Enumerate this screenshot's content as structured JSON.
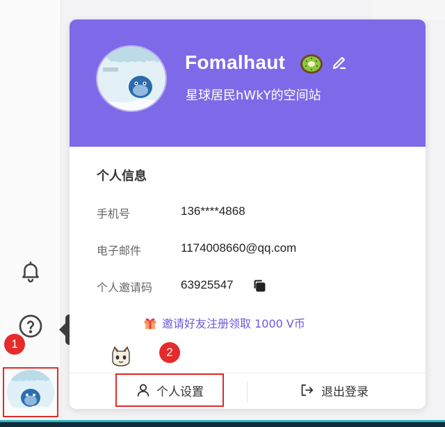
{
  "tooltip": {
    "help_label": "帮助"
  },
  "markers": {
    "one": "1",
    "two": "2"
  },
  "profile": {
    "username": "Fomalhaut",
    "space_name": "星球居民hWkY的空间站",
    "avatar_icon": "bird-in-snow-avatar",
    "emoji_icon": "kiwi-icon"
  },
  "info": {
    "section_title": "个人信息",
    "phone_label": "手机号",
    "phone_value": "136****4868",
    "email_label": "电子邮件",
    "email_value": "1174008660@qq.com",
    "invite_code_label": "个人邀请码",
    "invite_code_value": "63925547"
  },
  "invite": {
    "text": "邀请好友注册领取 1000 V币"
  },
  "actions": {
    "settings_label": "个人设置",
    "logout_label": "退出登录"
  },
  "colors": {
    "header_bg": "#7e6ae8",
    "accent": "#6a58de",
    "highlight_red": "#e02a2a"
  }
}
